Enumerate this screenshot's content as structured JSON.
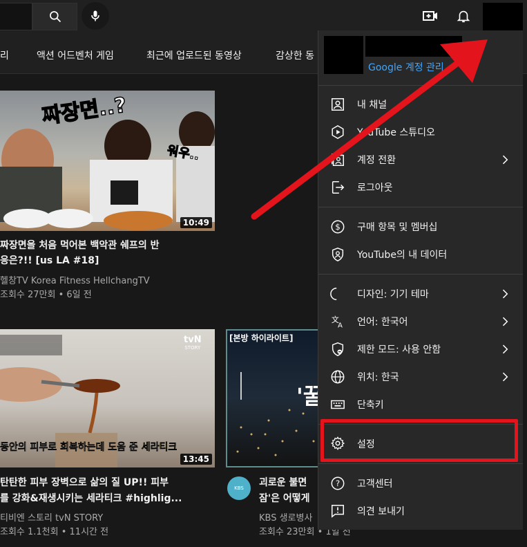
{
  "topbar": {
    "search_icon": "search-icon",
    "mic_icon": "mic-icon",
    "create_icon": "create-video-icon",
    "bell_icon": "bell-icon"
  },
  "chips": [
    "리",
    "액션 어드벤처 게임",
    "최근에 업로드된 동영상",
    "감상한 동"
  ],
  "videos": [
    {
      "title_line1": "짜장면을 처음 먹어본 백악관 쉐프의 반",
      "title_line2": "응은?!! [us LA #18]",
      "channel": "헬창TV Korea Fitness HellchangTV",
      "meta": "조회수 27만회 • 6일 전",
      "duration": "10:49",
      "thumb_text1": "짜장면..?",
      "thumb_text2": "워우.."
    },
    {
      "title_line1": "탄탄한 피부 장벽으로 삶의 질 UP!! 피부",
      "title_line2": "를 강화&재생시키는 세라티크 #highlig...",
      "channel": "티비엔 스토리 tvN STORY",
      "meta": "조회수 1.1천회 • 11시간 전",
      "duration": "13:45",
      "thumb_caption_plain": "동안의 피부로 회복하는데 도움 준 ",
      "thumb_caption_highlight": "세라티크",
      "thumb_logo_line1": "tvN",
      "thumb_logo_line2": "STORY"
    },
    {
      "title_line1": "괴로운 불면",
      "title_line2": "잠'은 어떻게",
      "channel": "KBS 생로병사",
      "meta": "조회수 23만회 • 1일 전",
      "thumb_badge": "[본방 하이라이트]",
      "thumb_big_text": "'꿀",
      "channel_avatar_text": "KBS"
    }
  ],
  "menu": {
    "manage_account": "Google 계정 관리",
    "items": [
      {
        "label": "내 채널",
        "icon": "person-icon",
        "chevron": false
      },
      {
        "label": "YouTube 스튜디오",
        "icon": "studio-icon",
        "chevron": false
      },
      {
        "label": "계정 전환",
        "icon": "switch-account-icon",
        "chevron": true
      },
      {
        "label": "로그아웃",
        "icon": "sign-out-icon",
        "chevron": false
      },
      {
        "label": "구매 항목 및 멤버십",
        "icon": "dollar-icon",
        "chevron": false
      },
      {
        "label": "YouTube의 내 데이터",
        "icon": "shield-person-icon",
        "chevron": false
      },
      {
        "label": "디자인: 기기 테마",
        "icon": "moon-icon",
        "chevron": true
      },
      {
        "label": "언어: 한국어",
        "icon": "translate-icon",
        "chevron": true
      },
      {
        "label": "제한 모드: 사용 안함",
        "icon": "restricted-mode-icon",
        "chevron": true
      },
      {
        "label": "위치: 한국",
        "icon": "globe-icon",
        "chevron": true
      },
      {
        "label": "단축키",
        "icon": "keyboard-icon",
        "chevron": false
      },
      {
        "label": "설정",
        "icon": "gear-icon",
        "chevron": false
      },
      {
        "label": "고객센터",
        "icon": "help-icon",
        "chevron": false
      },
      {
        "label": "의견 보내기",
        "icon": "feedback-icon",
        "chevron": false
      }
    ]
  },
  "annotation": {
    "highlight_color": "#e3141c",
    "arrow_color": "#e3141c"
  }
}
